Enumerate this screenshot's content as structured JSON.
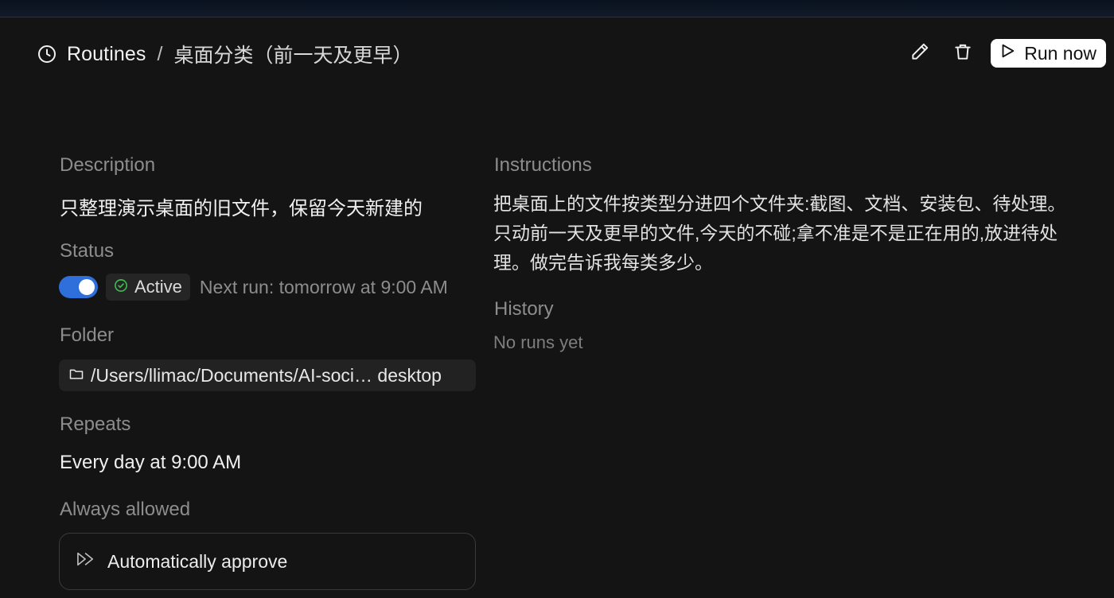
{
  "header": {
    "section": "Routines",
    "separator": "/",
    "title": "桌面分类（前一天及更早）",
    "run_now_label": "Run now"
  },
  "details": {
    "description_label": "Description",
    "description": "只整理演示桌面的旧文件，保留今天新建的",
    "status_label": "Status",
    "status_value": "Active",
    "toggle_on": true,
    "next_run": "Next run: tomorrow at 9:00 AM",
    "folder_label": "Folder",
    "folder_path": "/Users/llimac/Documents/AI-soci… desktop",
    "repeats_label": "Repeats",
    "repeats_value": "Every day at 9:00 AM",
    "always_allowed_label": "Always allowed",
    "always_allowed_item": "Automatically approve"
  },
  "instructions": {
    "label": "Instructions",
    "text": "把桌面上的文件按类型分进四个文件夹:截图、文档、安装包、待处理。只动前一天及更早的文件,今天的不碰;拿不准是不是正在用的,放进待处理。做完告诉我每类多少。"
  },
  "history": {
    "label": "History",
    "empty_text": "No runs yet"
  },
  "colors": {
    "background": "#141414",
    "toggle_accent": "#2f6fdb",
    "active_green": "#3fb950",
    "muted_text": "#8d8d8d"
  },
  "icons": [
    "clock-icon",
    "pencil-icon",
    "trash-icon",
    "play-icon",
    "check-circle-icon",
    "folder-icon",
    "fast-forward-icon"
  ]
}
